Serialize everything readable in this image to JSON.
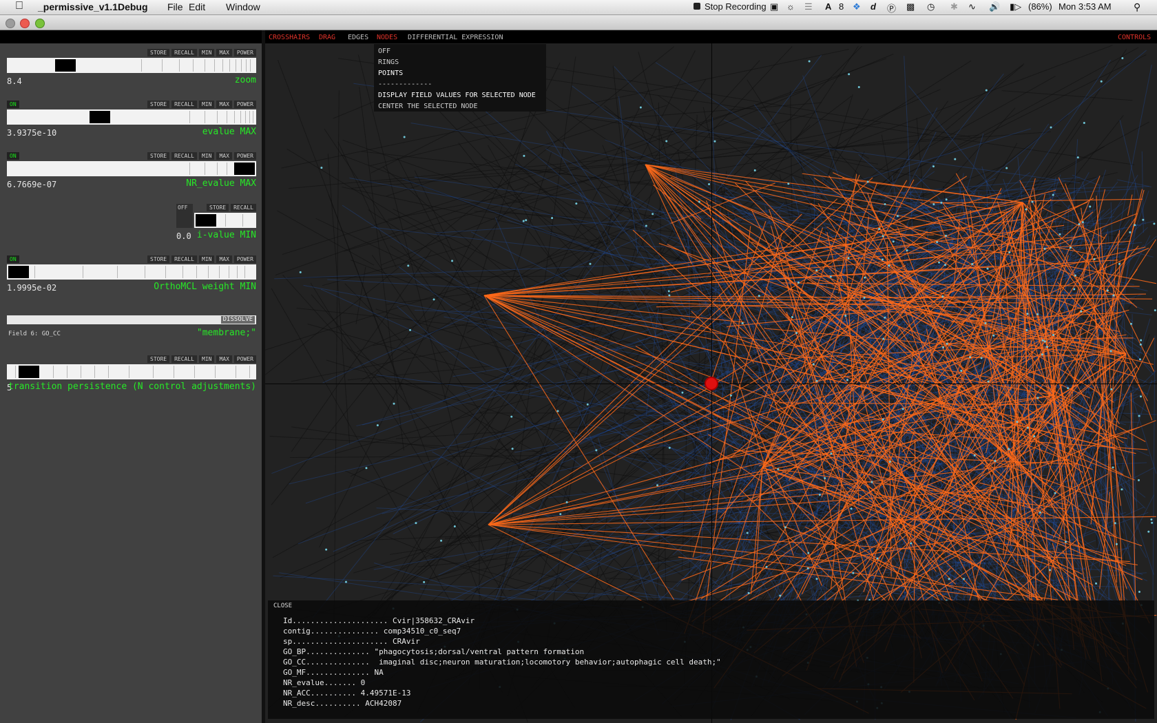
{
  "menubar": {
    "app_name": "_permissive_v1.1Debug",
    "items": [
      "File",
      "Edit",
      "Window"
    ],
    "stop_recording": "Stop Recording",
    "adobe_count": "8",
    "battery": "(86%)",
    "clock": "Mon 3:53 AM"
  },
  "controls": [
    {
      "on": "",
      "buttons": [
        "STORE",
        "RECALL",
        "MIN",
        "MAX",
        "POWER"
      ],
      "value": "8.4",
      "label": "zoom",
      "position": 0.21
    },
    {
      "on": "ON",
      "buttons": [
        "STORE",
        "RECALL",
        "MIN",
        "MAX",
        "POWER"
      ],
      "value": "3.9375e-10",
      "label": "evalue MAX",
      "position": 0.38
    },
    {
      "on": "ON",
      "buttons": [
        "STORE",
        "RECALL",
        "MIN",
        "MAX",
        "POWER"
      ],
      "value": "6.7669e-07",
      "label": "NR_evalue MAX",
      "position": 0.96
    },
    {
      "on": "OFF",
      "buttons": [
        "STORE",
        "RECALL"
      ],
      "value": "0.0",
      "label": "i-value MIN",
      "position": 0.05
    },
    {
      "on": "ON",
      "buttons": [
        "STORE",
        "RECALL",
        "MIN",
        "MAX",
        "POWER"
      ],
      "value": "1.9995e-02",
      "label": "OrthoMCL weight MIN",
      "position": 0.02
    },
    {
      "dissolve": "DISSOLVE",
      "field": "Field 6: GO_CC",
      "label": "\"membrane;\""
    },
    {
      "on": "",
      "buttons": [
        "STORE",
        "RECALL",
        "MIN",
        "MAX",
        "POWER"
      ],
      "value": "5",
      "label": "transition persistence (N control adjustments)",
      "position": 0.05
    }
  ],
  "viz_menu": {
    "crosshairs": "CROSSHAIRS",
    "drag": "DRAG",
    "edges": "EDGES",
    "nodes": "NODES",
    "diffexp": "DIFFERENTIAL EXPRESSION",
    "controls": "CONTROLS"
  },
  "nodes_menu": [
    "OFF",
    "RINGS",
    "POINTS",
    "-------------",
    "DISPLAY FIELD VALUES FOR SELECTED NODE",
    "CENTER THE SELECTED NODE"
  ],
  "info": {
    "close": "CLOSE",
    "rows": [
      {
        "key": "Id",
        "value": "Cvir|358632_CRAvir"
      },
      {
        "key": "contig",
        "value": "comp34510_c0_seq7"
      },
      {
        "key": "sp",
        "value": "CRAvir"
      },
      {
        "key": "GO_BP",
        "value": "\"phagocytosis;dorsal/ventral pattern formation"
      },
      {
        "key": "GO_CC",
        "value": " imaginal disc;neuron maturation;locomotory behavior;autophagic cell death;\""
      },
      {
        "key": "GO_MF",
        "value": "NA"
      },
      {
        "key": "NR_evalue",
        "value": "0"
      },
      {
        "key": "NR_ACC",
        "value": "4.49571E-13"
      },
      {
        "key": "NR_desc",
        "value": "ACH42087"
      }
    ]
  },
  "colors": {
    "accent_green": "#27e827",
    "menu_red": "#e0332a",
    "edge_orange": "#ff6a1a",
    "edge_blue": "#1f4fa8",
    "selected_node": "#e01010"
  }
}
